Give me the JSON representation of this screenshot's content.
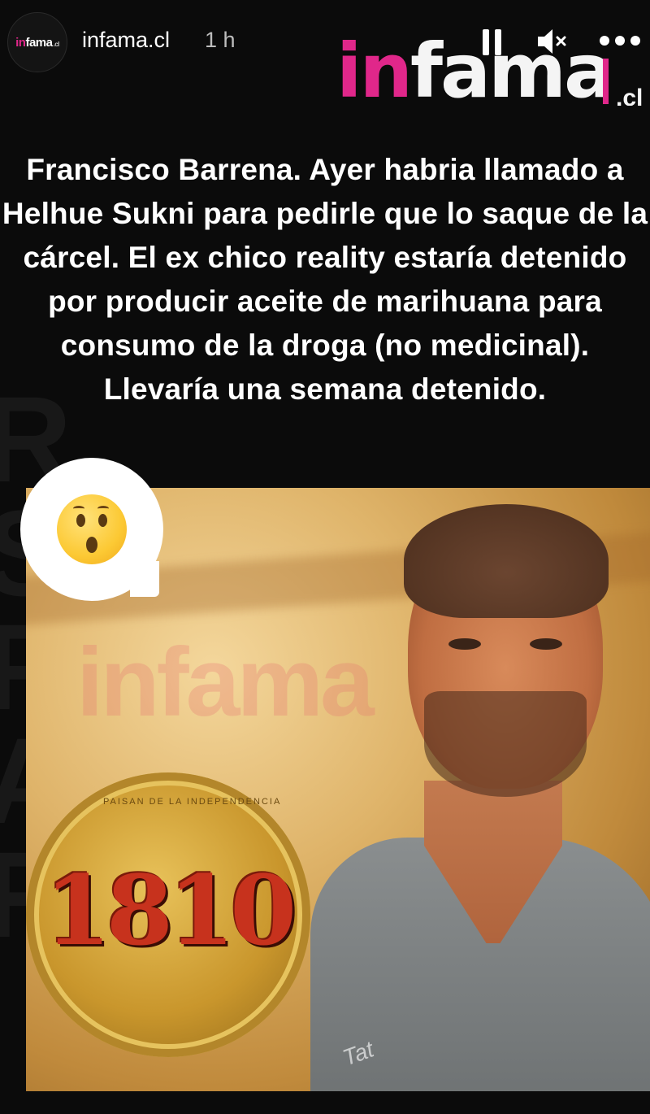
{
  "header": {
    "avatar_text_pink": "in",
    "avatar_text": "fama",
    "avatar_tld": ".cl",
    "username": "infama.cl",
    "time": "1 h",
    "icons": [
      "pause-icon",
      "mute-icon",
      "more-icon"
    ]
  },
  "brand": {
    "logo_pink": "in",
    "logo_main": "fama",
    "logo_tld": ".cl"
  },
  "post": {
    "headline": "Francisco Barrena. Ayer habria llamado a Helhue Sukni para pedirle que lo saque de la cárcel. El ex chico reality estaría detenido por producir aceite de marihuana para consumo de la droga (no medicinal). Llevaría una semana detenido.",
    "photo_watermark": "infama",
    "coin_label": "1810",
    "coin_rim": "PAISAN DE LA INDEPENDENCIA",
    "shirt_tag": "Tat"
  },
  "sticker": {
    "emoji": "surprised-face-icon"
  },
  "colors": {
    "background": "#0b0b0b",
    "brand_pink": "#e0278a",
    "text": "#ffffff",
    "muted": "#bdbdbd"
  }
}
